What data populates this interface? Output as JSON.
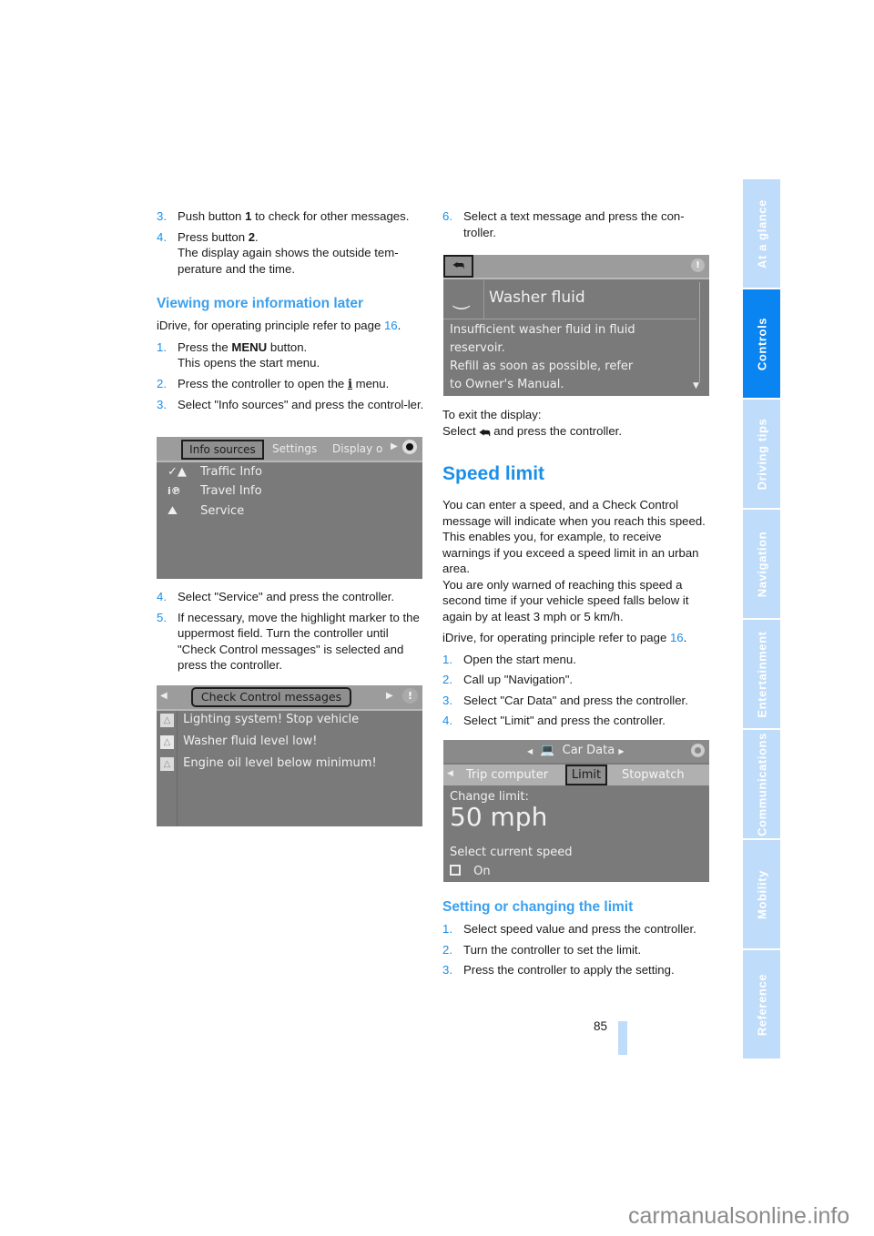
{
  "left_column": {
    "steps_a": [
      {
        "num": "3.",
        "text_before": "Push button ",
        "bold": "1",
        "text_after": " to check for other messages."
      },
      {
        "num": "4.",
        "text_before": "Press button ",
        "bold": "2",
        "text_after": ".",
        "line2": "The display again shows the outside tem-perature and the time."
      }
    ],
    "section_heading": "Viewing more information later",
    "idrive_ref": {
      "text": "iDrive, for operating principle refer to page ",
      "page": "16",
      "end": "."
    },
    "steps_b": [
      {
        "num": "1.",
        "text_before": "Press the ",
        "bold": "MENU",
        "text_after": " button.",
        "line2": "This opens the start menu."
      },
      {
        "num": "2.",
        "text_before": "Press the controller to open the ",
        "icon": "info-i-icon",
        "text_after": " menu."
      },
      {
        "num": "3.",
        "text": "Select \"Info sources\" and press the control-ler."
      }
    ],
    "screen_info": {
      "tabs": [
        "Info sources",
        "Settings",
        "Display o"
      ],
      "selected_tab": "Info sources",
      "items": [
        {
          "icon": "traffic-warning-icon",
          "label": "Traffic Info"
        },
        {
          "icon": "travel-info-icon",
          "label": "Travel Info"
        },
        {
          "icon": "service-car-icon",
          "label": "Service"
        }
      ]
    },
    "steps_c": [
      {
        "num": "4.",
        "text": "Select \"Service\" and press the controller."
      },
      {
        "num": "5.",
        "text": "If necessary, move the highlight marker to the uppermost field. Turn the controller until \"Check Control messages\" is selected and press the controller."
      }
    ],
    "screen_check_control": {
      "title": "Check Control messages",
      "messages": [
        "Lighting system! Stop vehicle",
        "Washer fluid level low!",
        "Engine oil level below minimum!"
      ]
    }
  },
  "right_column": {
    "step_6": {
      "num": "6.",
      "text": "Select a text message and press the con-troller."
    },
    "screen_washer": {
      "title": "Washer fluid",
      "body": [
        "Insufficient washer fluid in fluid",
        "reservoir.",
        "Refill as soon as possible, refer",
        "to Owner's Manual."
      ]
    },
    "exit_text": {
      "line1": "To exit the display:",
      "line2_before": "Select ",
      "line2_after": " and press the controller."
    },
    "speed_limit": {
      "heading": "Speed limit",
      "paragraph1": "You can enter a speed, and a Check Control message will indicate when you reach this speed. This enables you, for example, to receive warnings if you exceed a speed limit in an urban area.",
      "paragraph2": "You are only warned of reaching this speed a second time if your vehicle speed falls below it again by at least 3 mph or 5 km/h.",
      "idrive_ref": {
        "text": "iDrive, for operating principle refer to page ",
        "page": "16",
        "end": "."
      },
      "steps": [
        {
          "num": "1.",
          "text": "Open the start menu."
        },
        {
          "num": "2.",
          "text": "Call up \"Navigation\"."
        },
        {
          "num": "3.",
          "text": "Select \"Car Data\" and press the controller."
        },
        {
          "num": "4.",
          "text": "Select \"Limit\" and press the controller."
        }
      ]
    },
    "screen_car_data": {
      "title": "Car Data",
      "tabs": [
        "Trip computer",
        "Limit",
        "Stopwatch"
      ],
      "selected_tab": "Limit",
      "change_label": "Change limit:",
      "value": "50 mph",
      "option_label": "Select current speed",
      "checkbox_label": "On"
    },
    "setting": {
      "heading": "Setting or changing the limit",
      "steps": [
        {
          "num": "1.",
          "text": "Select speed value and press the controller."
        },
        {
          "num": "2.",
          "text": "Turn the controller to set the limit."
        },
        {
          "num": "3.",
          "text": "Press the controller to apply the setting."
        }
      ]
    }
  },
  "side_tabs": [
    {
      "label": "At a glance",
      "active": false
    },
    {
      "label": "Controls",
      "active": true
    },
    {
      "label": "Driving tips",
      "active": false
    },
    {
      "label": "Navigation",
      "active": false
    },
    {
      "label": "Entertainment",
      "active": false
    },
    {
      "label": "Communications",
      "active": false
    },
    {
      "label": "Mobility",
      "active": false
    },
    {
      "label": "Reference",
      "active": false
    }
  ],
  "page_number": "85",
  "watermark": "carmanualsonline.info",
  "colors": {
    "accent": "#1a8fe8",
    "heading": "#3aa0ee",
    "tab_inactive": "#bfdcfa",
    "tab_active": "#0a84f0",
    "screen_bg": "#7a7a7a"
  }
}
